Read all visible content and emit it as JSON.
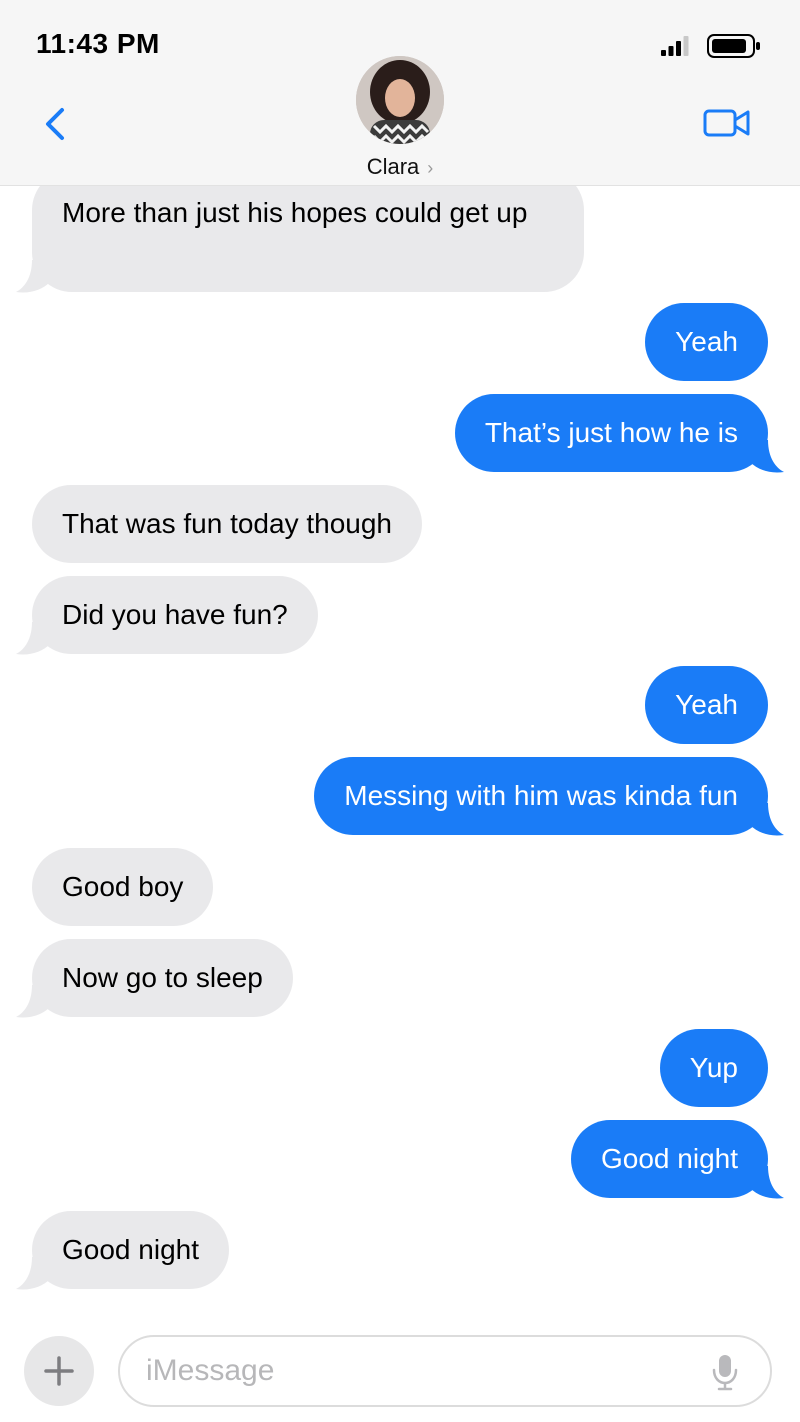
{
  "status_bar": {
    "time": "11:43 PM"
  },
  "header": {
    "contact_name": "Clara",
    "contact_chevron": "›",
    "back_icon": "chevron-left-icon",
    "video_icon": "video-camera-icon"
  },
  "colors": {
    "accent": "#1a7cf7",
    "incoming_bubble": "#e9e9eb",
    "header_bg": "#f6f6f6"
  },
  "messages": [
    {
      "direction": "incoming",
      "text": "More than just his hopes could get up"
    },
    {
      "direction": "outgoing",
      "text": "Yeah"
    },
    {
      "direction": "outgoing",
      "text": "That’s just how he is"
    },
    {
      "direction": "incoming",
      "text": "That was fun today though"
    },
    {
      "direction": "incoming",
      "text": "Did you have fun?"
    },
    {
      "direction": "outgoing",
      "text": "Yeah"
    },
    {
      "direction": "outgoing",
      "text": "Messing with him was kinda fun"
    },
    {
      "direction": "incoming",
      "text": "Good boy"
    },
    {
      "direction": "incoming",
      "text": "Now go to sleep"
    },
    {
      "direction": "outgoing",
      "text": "Yup"
    },
    {
      "direction": "outgoing",
      "text": "Good night"
    },
    {
      "direction": "incoming",
      "text": "Good night"
    }
  ],
  "composer": {
    "placeholder": "iMessage",
    "plus_icon": "plus-icon",
    "mic_icon": "microphone-icon"
  }
}
